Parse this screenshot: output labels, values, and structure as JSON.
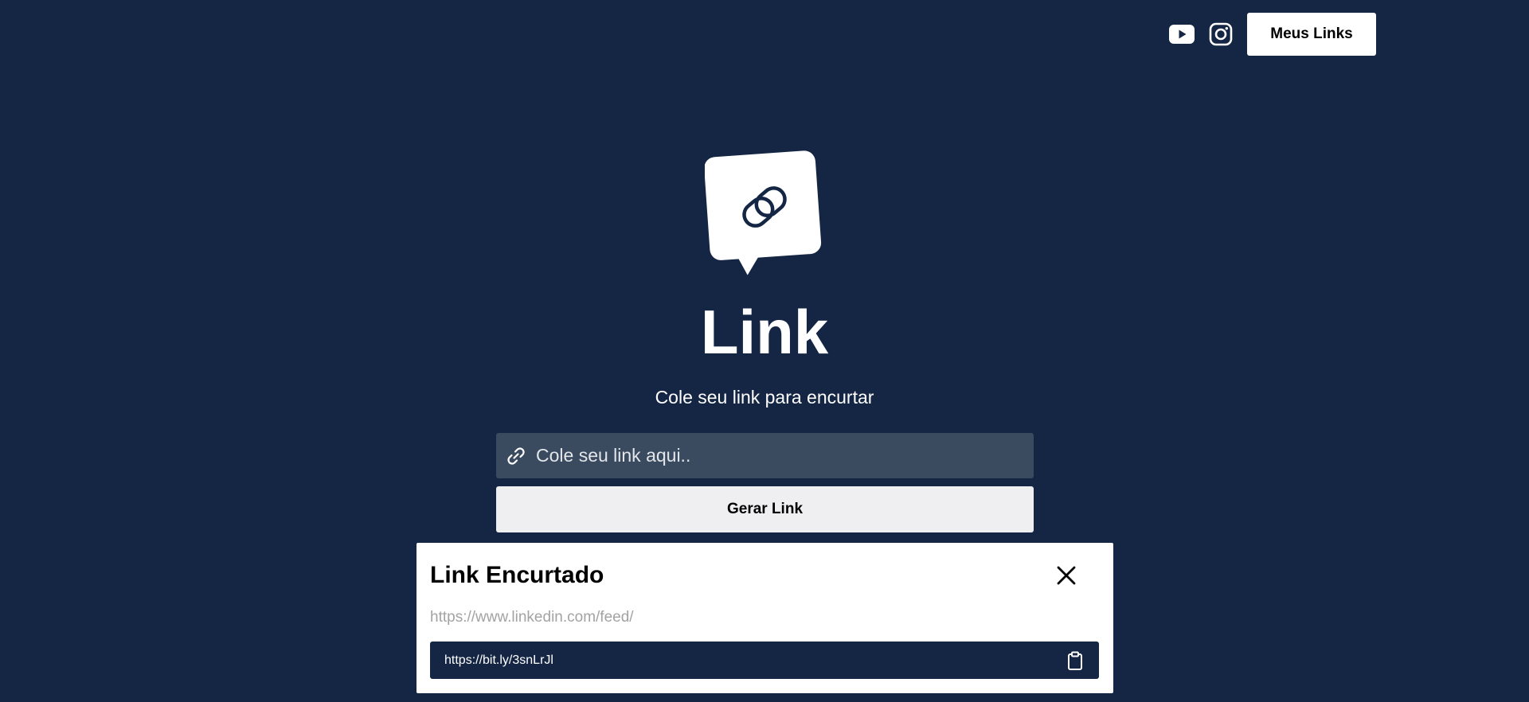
{
  "header": {
    "social_icons": [
      "youtube-icon",
      "instagram-icon"
    ],
    "my_links_label": "Meus Links"
  },
  "hero": {
    "logo_icon": "link-chat-bubble-icon",
    "title": "Link",
    "subtitle": "Cole seu link para encurtar"
  },
  "form": {
    "input_icon": "link-icon",
    "placeholder": "Cole seu link aqui..",
    "value": "",
    "generate_label": "Gerar Link"
  },
  "modal": {
    "title": "Link Encurtado",
    "close_icon": "close-icon",
    "original_url": "https://www.linkedin.com/feed/",
    "short_url": "https://bit.ly/3snLrJl",
    "copy_icon": "clipboard-icon"
  },
  "colors": {
    "background": "#142644",
    "input_background": "#3a4a5f",
    "button_light": "#efeff1",
    "modal_background": "#ffffff",
    "muted_text": "#a3a3a3"
  }
}
